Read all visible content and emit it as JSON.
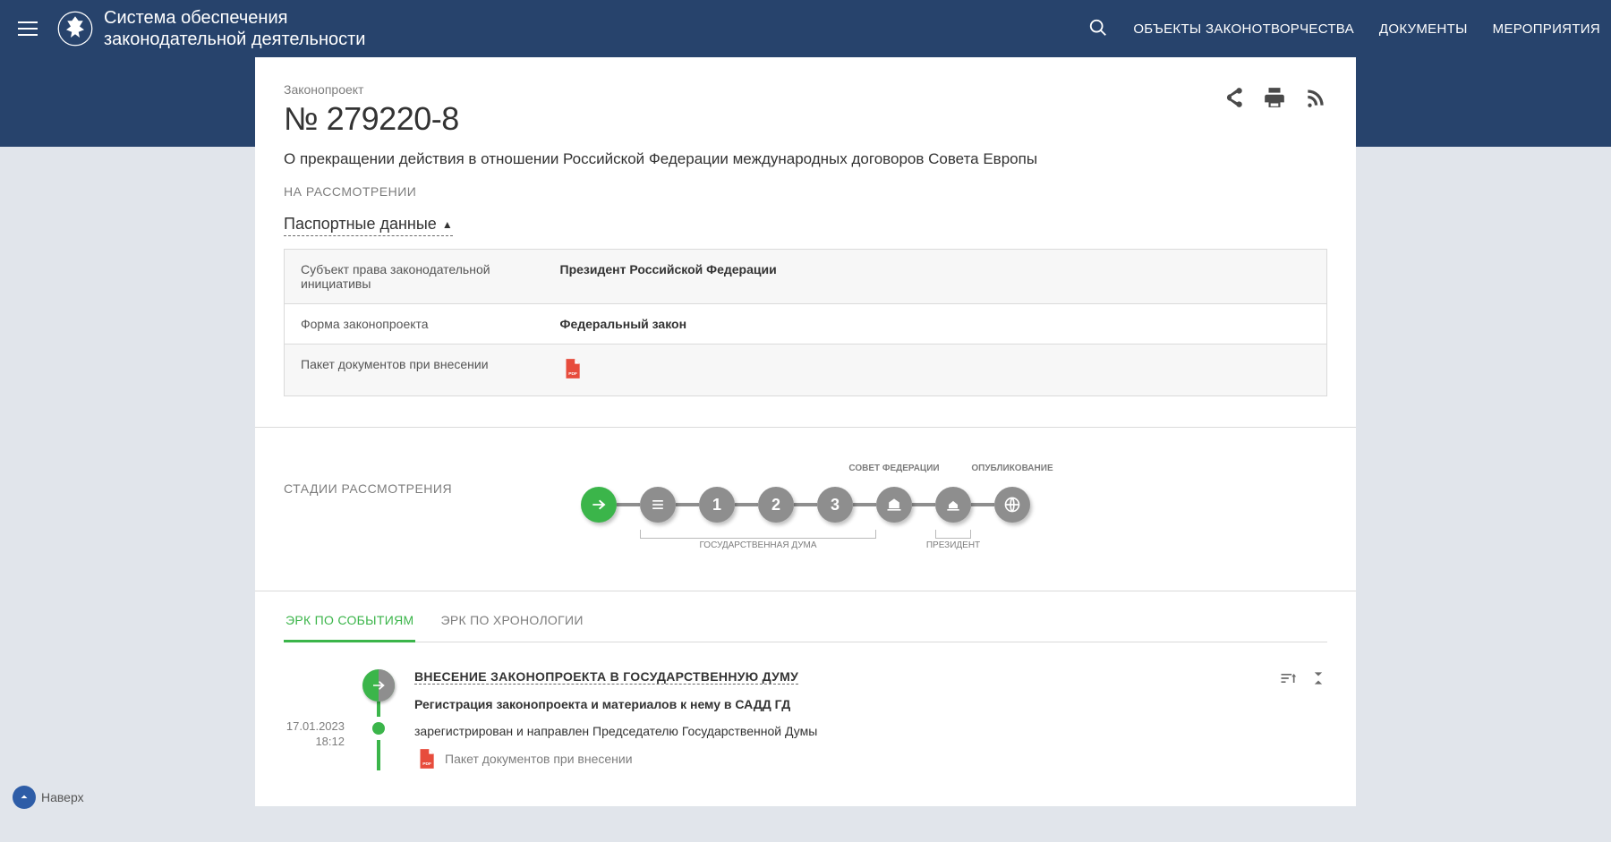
{
  "header": {
    "title_line1": "Система обеспечения",
    "title_line2": "законодательной деятельности",
    "nav": {
      "objects": "ОБЪЕКТЫ ЗАКОНОТВОРЧЕСТВА",
      "documents": "ДОКУМЕНТЫ",
      "events": "МЕРОПРИЯТИЯ"
    }
  },
  "bill": {
    "kind": "Законопроект",
    "number": "№ 279220-8",
    "desc": "О прекращении действия в отношении Российской Федерации международных договоров Совета Европы",
    "status": "НА РАССМОТРЕНИИ"
  },
  "passport": {
    "toggle": "Паспортные данные",
    "rows": {
      "subject_k": "Субъект права законодательной инициативы",
      "subject_v": "Президент Российской Федерации",
      "form_k": "Форма законопроекта",
      "form_v": "Федеральный закон",
      "pack_k": "Пакет документов при внесении"
    }
  },
  "stages": {
    "label": "СТАДИИ РАССМОТРЕНИЯ",
    "duma_label": "ГОСУДАРСТВЕННАЯ ДУМА",
    "sovfed_label": "СОВЕТ ФЕДЕРАЦИИ",
    "prez_label": "ПРЕЗИДЕНТ",
    "publ_label": "ОПУБЛИКОВАНИЕ",
    "read1": "1",
    "read2": "2",
    "read3": "3"
  },
  "tabs": {
    "by_events": "ЭРК ПО СОБЫТИЯМ",
    "by_chrono": "ЭРК ПО ХРОНОЛОГИИ"
  },
  "events": {
    "e1": {
      "title": "ВНЕСЕНИЕ ЗАКОНОПРОЕКТА В ГОСУДАРСТВЕННУЮ ДУМУ",
      "sub": "Регистрация законопроекта и материалов к нему в САДД ГД",
      "text": "зарегистрирован и направлен Председателю Государственной Думы",
      "doc": "Пакет документов при внесении",
      "date": "17.01.2023",
      "time": "18:12"
    }
  },
  "to_top": "Наверх"
}
